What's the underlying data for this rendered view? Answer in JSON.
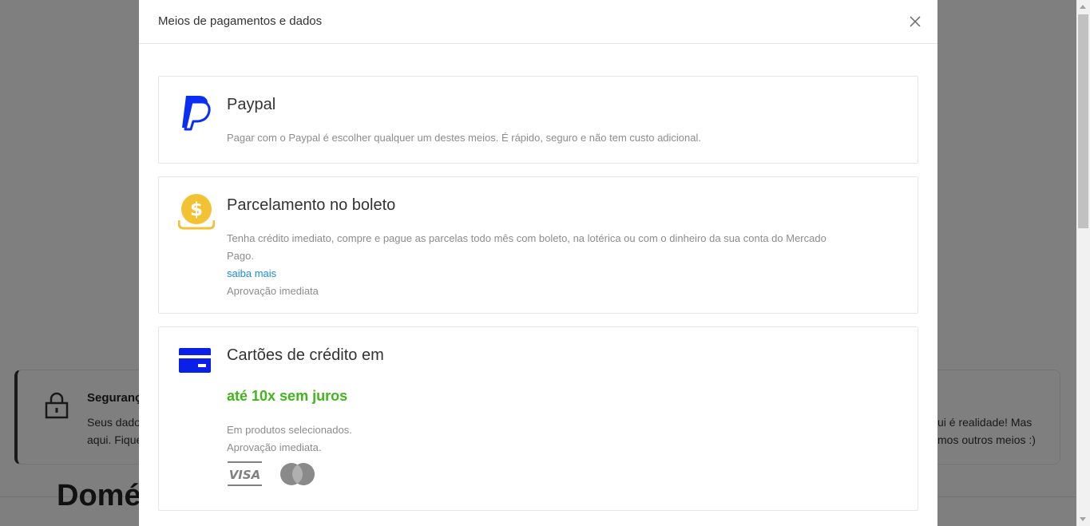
{
  "background": {
    "security_title": "Seguranç",
    "security_line1": "Seus dado",
    "security_line2": "aqui. Fique",
    "right_line1": "ui é realidade! Mas",
    "right_line2": "mos outros meios :)",
    "heading": "Domé"
  },
  "modal": {
    "title": "Meios de pagamentos e dados",
    "close_icon": "close-icon"
  },
  "options": [
    {
      "icon": "paypal-icon",
      "title": "Paypal",
      "description": "Pagar com o Paypal é escolher qualquer um destes meios. É rápido, seguro e não tem custo adicional."
    },
    {
      "icon": "coin-icon",
      "title": "Parcelamento no boleto",
      "description_line1": "Tenha crédito imediato, compre e pague as parcelas todo mês com boleto, na lotérica ou com o dinheiro da sua conta do Mercado",
      "description_line2": "Pago.",
      "link": "saiba mais",
      "note": "Aprovação imediata"
    },
    {
      "icon": "credit-card-icon",
      "title": "Cartões de crédito em",
      "highlight": "até 10x sem juros",
      "line1": "Em produtos selecionados.",
      "line2": "Aprovação imediata.",
      "brands": [
        "VISA",
        "mastercard"
      ]
    }
  ],
  "colors": {
    "link": "#1b8de0",
    "highlight": "#41b61b",
    "paypal_blue": "#0b2ef5",
    "coin_yellow": "#f2c233",
    "card_blue": "#0a1fe8"
  }
}
